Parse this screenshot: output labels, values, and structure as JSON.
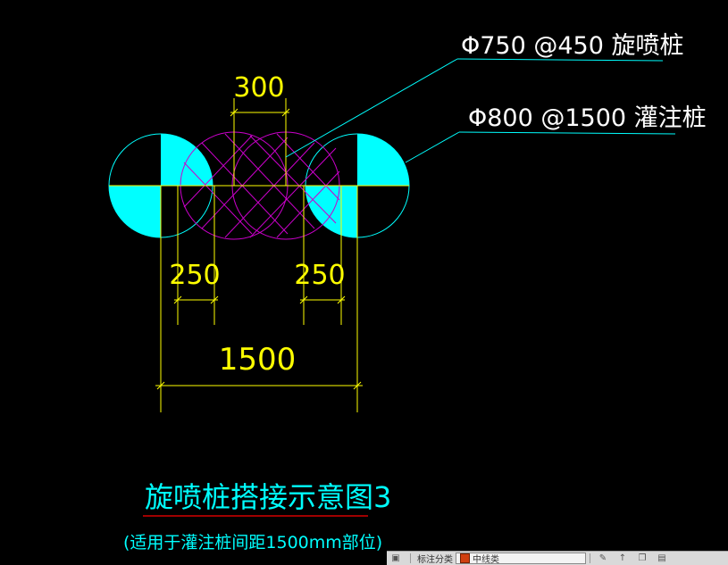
{
  "drawing": {
    "label_jet_pile": "Φ750 @450 旋喷桩",
    "label_bored_pile": "Φ800 @1500 灌注桩",
    "dim_top": "300",
    "dim_left": "250",
    "dim_right": "250",
    "dim_bottom": "1500",
    "title": "旋喷桩搭接示意图3",
    "subtitle": "(适用于灌注桩间距1500mm部位)"
  },
  "statusbar": {
    "icon_left": "model-space-icon",
    "label_layer_filter": "标注分类",
    "layer_name": "中线类",
    "icons": [
      "annotate-icon",
      "arrow-up-icon",
      "copy-icon",
      "layer-icon"
    ]
  },
  "colors": {
    "background": "#000000",
    "dimension": "#ffff00",
    "leader": "#00ffff",
    "jet_pile": "#cc00cc",
    "fill": "#00ffff",
    "title_underline": "#ff0000"
  }
}
